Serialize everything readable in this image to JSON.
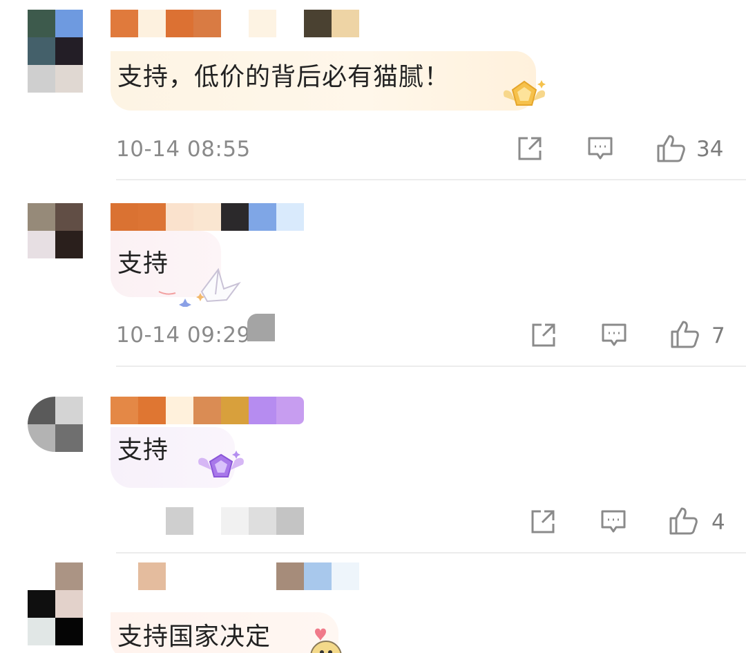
{
  "comments": [
    {
      "text": "支持，低价的背后必有猫腻！",
      "time": "10-14 08:55",
      "likes": "34",
      "colors": {
        "avatar": [
          "#3d5a4c",
          "#6e9ae0",
          "#44606a",
          "#231e26",
          "#cfcfcf",
          "#e0d8d2"
        ],
        "name": [
          "#e07a3c",
          "#fdf1df",
          "#dc7133",
          "#d97b43",
          "#ffffff",
          "#fdf3e3",
          "#ffffff",
          "#4a4131",
          "#eed4a5"
        ],
        "bubble": "#fdf3e1"
      }
    },
    {
      "text": "支持",
      "time": "10-14 09:29",
      "likes": "7",
      "colors": {
        "avatar": [
          "#968a79",
          "#614e45",
          "#e7dfe3",
          "#2a1f1c",
          "#ffffff",
          "#ffffff"
        ],
        "name": [
          "#da7232",
          "#dc7434",
          "#fae2cd",
          "#fae6d1",
          "#2b292b",
          "#7fa6e6",
          "#d9eafc"
        ],
        "bubble": "#fbf2f5"
      }
    },
    {
      "text": "支持",
      "time": "",
      "likes": "4",
      "colors": {
        "avatar": [
          "#5a5a5a",
          "#d4d4d4",
          "#b3b3b3",
          "#6f6f6f",
          "#ffffff",
          "#ffffff"
        ],
        "name": [
          "#e48846",
          "#df7632",
          "#fff1dc",
          "#da8c54",
          "#d8a03c",
          "#b68cf0",
          "#c79df0"
        ],
        "bubble": "#f7f1fa"
      }
    },
    {
      "text": "支持国家决定",
      "colors": {
        "avatar": [
          "#ffffff",
          "#ab9484",
          "#0f0f0f",
          "#e3d2cb",
          "#e1e7e6",
          "#050505"
        ],
        "name": [
          "#ffffff",
          "#ffffff",
          "#e4bc9e",
          "#ffffff",
          "#ffffff",
          "#ffffff",
          "#a68c7a",
          "#a8c8ec",
          "#eef5fb"
        ],
        "bubble": "#fff4f0"
      }
    }
  ],
  "icons": {
    "share": "share-icon",
    "comment": "comment-icon",
    "like": "thumbs-up-icon"
  }
}
